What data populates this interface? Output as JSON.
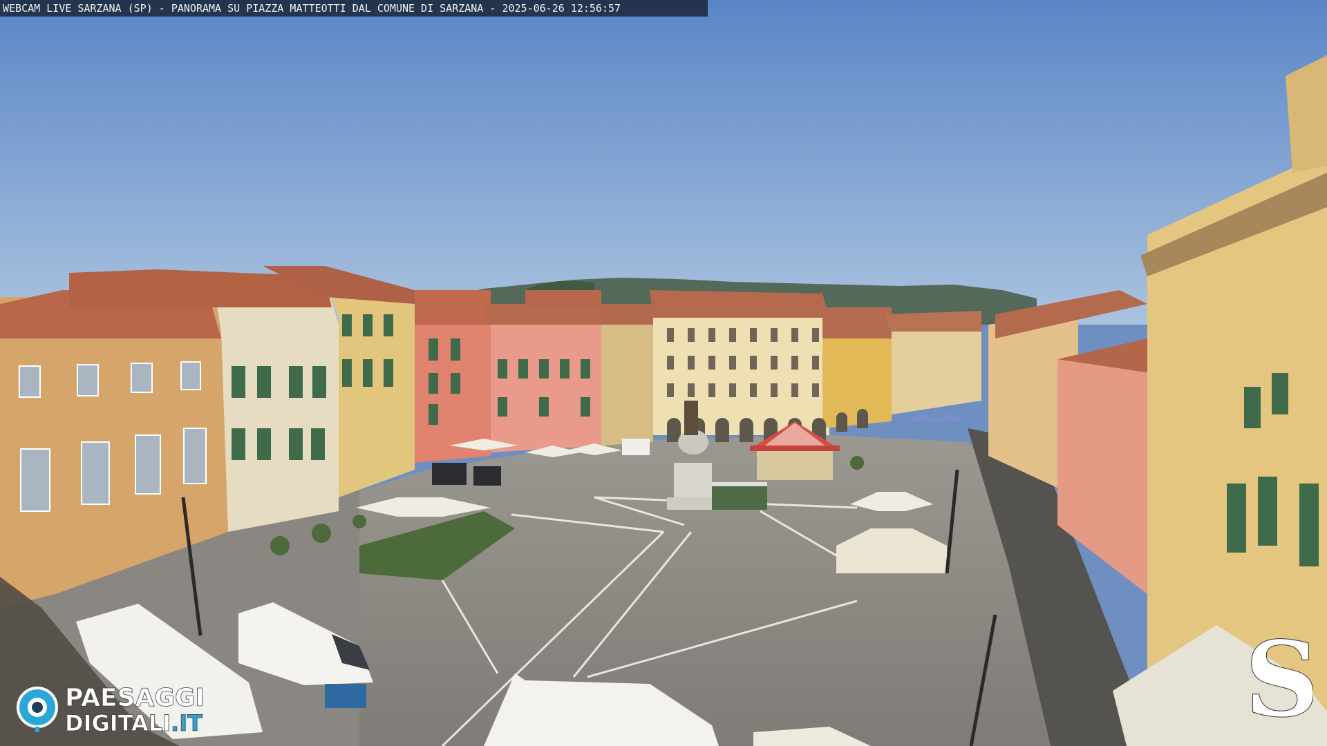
{
  "overlay": {
    "title": "WEBCAM LIVE SARZANA (SP) - PANORAMA SU PIAZZA MATTEOTTI DAL COMUNE DI SARZANA - 2025-06-26  12:56:57"
  },
  "watermark_left": {
    "line1": "PAESAGGI",
    "line2": "DIGITALI",
    "suffix": ".IT"
  },
  "watermark_right": {
    "mark": "S"
  },
  "colors": {
    "sky_top": "#5d87c8",
    "sky_bottom": "#a9c1de",
    "pavement": "#8c8a86",
    "roof": "#b8674a",
    "building_ochre": "#d8a86a",
    "building_pink": "#e0836f",
    "building_cream": "#e8dcc0",
    "building_yellow": "#e2c77d",
    "shutter_green": "#3f6b4a",
    "umbrella": "#f1ece2",
    "logo_blue": "#2aa7d8"
  }
}
